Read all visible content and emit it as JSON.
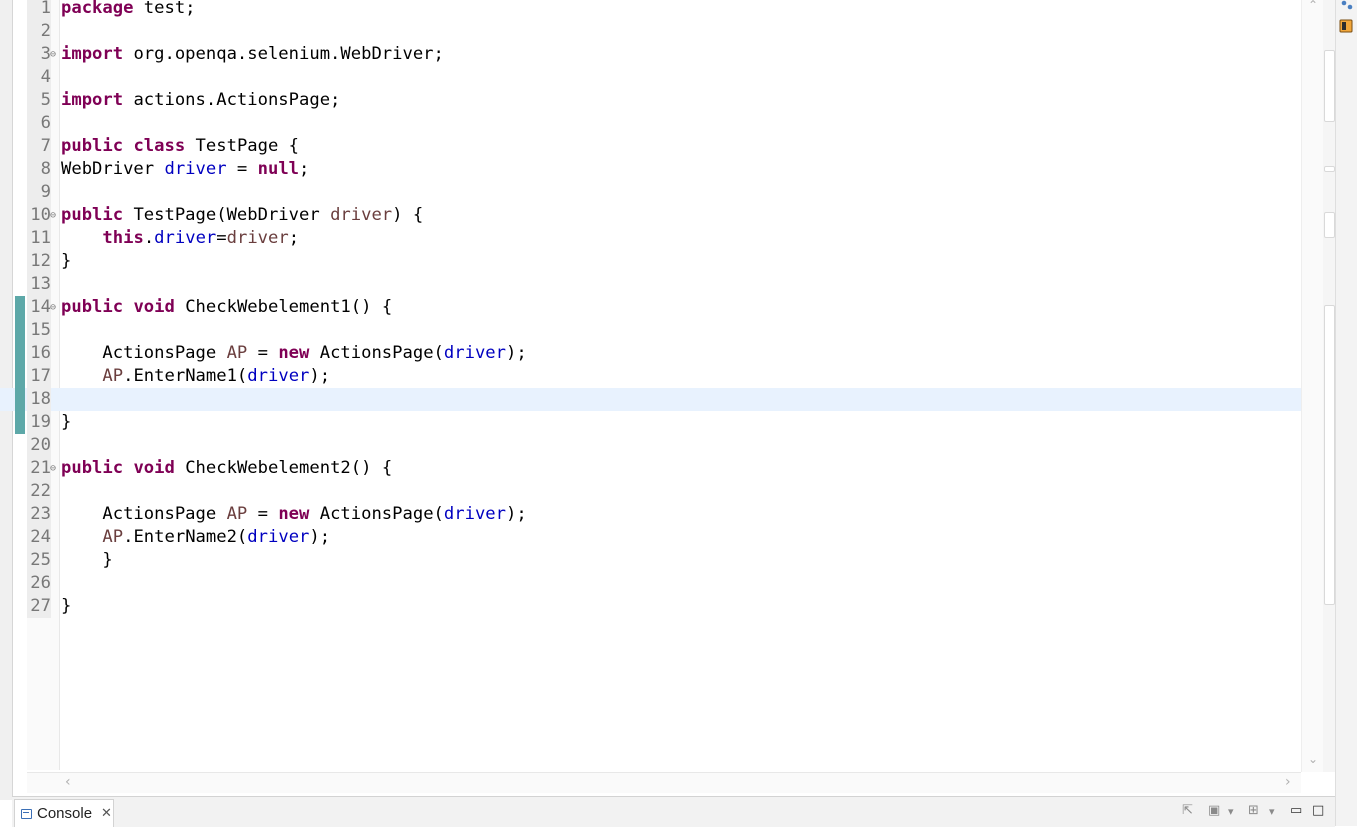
{
  "editor": {
    "lines": [
      {
        "n": "1",
        "fold": "",
        "tokens": [
          [
            "kw",
            "package"
          ],
          [
            "nm",
            " test;"
          ]
        ]
      },
      {
        "n": "2",
        "fold": "",
        "tokens": []
      },
      {
        "n": "3",
        "fold": "⊖",
        "tokens": [
          [
            "kw",
            "import"
          ],
          [
            "nm",
            " org.openqa.selenium.WebDriver;"
          ]
        ]
      },
      {
        "n": "4",
        "fold": "",
        "tokens": []
      },
      {
        "n": "5",
        "fold": "",
        "tokens": [
          [
            "kw",
            "import"
          ],
          [
            "nm",
            " actions.ActionsPage;"
          ]
        ]
      },
      {
        "n": "6",
        "fold": "",
        "tokens": []
      },
      {
        "n": "7",
        "fold": "",
        "tokens": [
          [
            "kw",
            "public"
          ],
          [
            "nm",
            " "
          ],
          [
            "kw",
            "class"
          ],
          [
            "nm",
            " TestPage {"
          ]
        ]
      },
      {
        "n": "8",
        "fold": "",
        "tokens": [
          [
            "nm",
            "WebDriver "
          ],
          [
            "fld",
            "driver"
          ],
          [
            "nm",
            " = "
          ],
          [
            "kw",
            "null"
          ],
          [
            "nm",
            ";"
          ]
        ]
      },
      {
        "n": "9",
        "fold": "",
        "tokens": []
      },
      {
        "n": "10",
        "fold": "⊖",
        "tokens": [
          [
            "kw",
            "public"
          ],
          [
            "nm",
            " TestPage(WebDriver "
          ],
          [
            "prm",
            "driver"
          ],
          [
            "nm",
            ") {"
          ]
        ]
      },
      {
        "n": "11",
        "fold": "",
        "tokens": [
          [
            "nm",
            "    "
          ],
          [
            "kw",
            "this"
          ],
          [
            "nm",
            "."
          ],
          [
            "fld",
            "driver"
          ],
          [
            "nm",
            "="
          ],
          [
            "prm",
            "driver"
          ],
          [
            "nm",
            ";"
          ]
        ]
      },
      {
        "n": "12",
        "fold": "",
        "tokens": [
          [
            "nm",
            "}"
          ]
        ]
      },
      {
        "n": "13",
        "fold": "",
        "tokens": []
      },
      {
        "n": "14",
        "fold": "⊖",
        "change": true,
        "tokens": [
          [
            "kw",
            "public"
          ],
          [
            "nm",
            " "
          ],
          [
            "kw",
            "void"
          ],
          [
            "nm",
            " CheckWebelement1() {"
          ]
        ]
      },
      {
        "n": "15",
        "fold": "",
        "change": true,
        "tokens": []
      },
      {
        "n": "16",
        "fold": "",
        "change": true,
        "tokens": [
          [
            "nm",
            "    ActionsPage "
          ],
          [
            "prm",
            "AP"
          ],
          [
            "nm",
            " = "
          ],
          [
            "kw",
            "new"
          ],
          [
            "nm",
            " ActionsPage("
          ],
          [
            "fld",
            "driver"
          ],
          [
            "nm",
            ");"
          ]
        ]
      },
      {
        "n": "17",
        "fold": "",
        "change": true,
        "tokens": [
          [
            "nm",
            "    "
          ],
          [
            "prm",
            "AP"
          ],
          [
            "nm",
            ".EnterName1("
          ],
          [
            "fld",
            "driver"
          ],
          [
            "nm",
            ");"
          ]
        ]
      },
      {
        "n": "18",
        "fold": "",
        "change": true,
        "current": true,
        "tokens": []
      },
      {
        "n": "19",
        "fold": "",
        "change": true,
        "tokens": [
          [
            "nm",
            "}"
          ]
        ]
      },
      {
        "n": "20",
        "fold": "",
        "tokens": []
      },
      {
        "n": "21",
        "fold": "⊖",
        "tokens": [
          [
            "kw",
            "public"
          ],
          [
            "nm",
            " "
          ],
          [
            "kw",
            "void"
          ],
          [
            "nm",
            " CheckWebelement2() {"
          ]
        ]
      },
      {
        "n": "22",
        "fold": "",
        "tokens": []
      },
      {
        "n": "23",
        "fold": "",
        "tokens": [
          [
            "nm",
            "    ActionsPage "
          ],
          [
            "prm",
            "AP"
          ],
          [
            "nm",
            " = "
          ],
          [
            "kw",
            "new"
          ],
          [
            "nm",
            " ActionsPage("
          ],
          [
            "fld",
            "driver"
          ],
          [
            "nm",
            ");"
          ]
        ]
      },
      {
        "n": "24",
        "fold": "",
        "tokens": [
          [
            "nm",
            "    "
          ],
          [
            "prm",
            "AP"
          ],
          [
            "nm",
            ".EnterName2("
          ],
          [
            "fld",
            "driver"
          ],
          [
            "nm",
            ");"
          ]
        ]
      },
      {
        "n": "25",
        "fold": "",
        "tokens": [
          [
            "nm",
            "    }"
          ]
        ]
      },
      {
        "n": "26",
        "fold": "",
        "tokens": []
      },
      {
        "n": "27",
        "fold": "",
        "tokens": [
          [
            "nm",
            "}"
          ]
        ]
      }
    ]
  },
  "console": {
    "tab_label": "Console",
    "close_glyph": "✕"
  },
  "icons": {
    "scroll_up": "⌃",
    "scroll_down": "⌄",
    "scroll_left": "‹",
    "scroll_right": "›",
    "pin": "⇱",
    "display": "▣",
    "dropdown": "▾",
    "new_console": "⊞",
    "minimize": "▭",
    "maximize": "□"
  },
  "colors": {
    "keyword": "#7f0055",
    "field": "#0000c0",
    "parameter": "#6a3e3e",
    "current_line": "#e8f2fe",
    "change_bar": "#5da8a8"
  }
}
